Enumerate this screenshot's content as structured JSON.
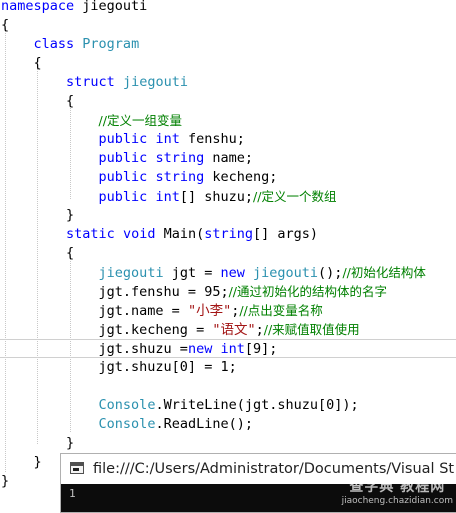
{
  "editor": {
    "colors": {
      "keyword": "#0000ff",
      "type": "#2b91af",
      "string": "#a31515",
      "comment": "#008000",
      "text": "#000000"
    },
    "lines": [
      {
        "tokens": [
          {
            "t": "kw",
            "v": "namespace"
          },
          {
            "t": "tx",
            "v": " jiegouti"
          }
        ]
      },
      {
        "tokens": [
          {
            "t": "tx",
            "v": "{"
          }
        ]
      },
      {
        "tokens": [
          {
            "t": "tx",
            "v": "    "
          },
          {
            "t": "kw",
            "v": "class"
          },
          {
            "t": "tx",
            "v": " "
          },
          {
            "t": "ty",
            "v": "Program"
          }
        ]
      },
      {
        "tokens": [
          {
            "t": "tx",
            "v": "    {"
          }
        ]
      },
      {
        "tokens": [
          {
            "t": "tx",
            "v": "        "
          },
          {
            "t": "kw",
            "v": "struct"
          },
          {
            "t": "tx",
            "v": " "
          },
          {
            "t": "ty",
            "v": "jiegouti"
          }
        ]
      },
      {
        "tokens": [
          {
            "t": "tx",
            "v": "        {"
          }
        ]
      },
      {
        "tokens": [
          {
            "t": "tx",
            "v": "            "
          },
          {
            "t": "cm",
            "v": "//定义一组变量"
          }
        ]
      },
      {
        "tokens": [
          {
            "t": "tx",
            "v": "            "
          },
          {
            "t": "kw",
            "v": "public"
          },
          {
            "t": "tx",
            "v": " "
          },
          {
            "t": "kw",
            "v": "int"
          },
          {
            "t": "tx",
            "v": " fenshu;"
          }
        ]
      },
      {
        "tokens": [
          {
            "t": "tx",
            "v": "            "
          },
          {
            "t": "kw",
            "v": "public"
          },
          {
            "t": "tx",
            "v": " "
          },
          {
            "t": "kw",
            "v": "string"
          },
          {
            "t": "tx",
            "v": " name;"
          }
        ]
      },
      {
        "tokens": [
          {
            "t": "tx",
            "v": "            "
          },
          {
            "t": "kw",
            "v": "public"
          },
          {
            "t": "tx",
            "v": " "
          },
          {
            "t": "kw",
            "v": "string"
          },
          {
            "t": "tx",
            "v": " kecheng;"
          }
        ]
      },
      {
        "tokens": [
          {
            "t": "tx",
            "v": "            "
          },
          {
            "t": "kw",
            "v": "public"
          },
          {
            "t": "tx",
            "v": " "
          },
          {
            "t": "kw",
            "v": "int"
          },
          {
            "t": "tx",
            "v": "[] shuzu;"
          },
          {
            "t": "cm",
            "v": "//定义一个数组"
          }
        ]
      },
      {
        "tokens": [
          {
            "t": "tx",
            "v": "        }"
          }
        ]
      },
      {
        "tokens": [
          {
            "t": "tx",
            "v": "        "
          },
          {
            "t": "kw",
            "v": "static"
          },
          {
            "t": "tx",
            "v": " "
          },
          {
            "t": "kw",
            "v": "void"
          },
          {
            "t": "tx",
            "v": " Main("
          },
          {
            "t": "kw",
            "v": "string"
          },
          {
            "t": "tx",
            "v": "[] args)"
          }
        ]
      },
      {
        "tokens": [
          {
            "t": "tx",
            "v": "        {"
          }
        ]
      },
      {
        "tokens": [
          {
            "t": "tx",
            "v": "            "
          },
          {
            "t": "ty",
            "v": "jiegouti"
          },
          {
            "t": "tx",
            "v": " jgt = "
          },
          {
            "t": "kw",
            "v": "new"
          },
          {
            "t": "tx",
            "v": " "
          },
          {
            "t": "ty",
            "v": "jiegouti"
          },
          {
            "t": "tx",
            "v": "();"
          },
          {
            "t": "cm",
            "v": "//初始化结构体"
          }
        ]
      },
      {
        "tokens": [
          {
            "t": "tx",
            "v": "            jgt.fenshu = 95;"
          },
          {
            "t": "cm",
            "v": "//通过初始化的结构体的名字"
          }
        ]
      },
      {
        "tokens": [
          {
            "t": "tx",
            "v": "            jgt.name = "
          },
          {
            "t": "str",
            "v": "\"小李\""
          },
          {
            "t": "tx",
            "v": ";"
          },
          {
            "t": "cm",
            "v": "//点出变量名称"
          }
        ]
      },
      {
        "tokens": [
          {
            "t": "tx",
            "v": "            jgt.kecheng = "
          },
          {
            "t": "str",
            "v": "\"语文\""
          },
          {
            "t": "tx",
            "v": ";"
          },
          {
            "t": "cm",
            "v": "//来赋值取值使用"
          }
        ]
      },
      {
        "tokens": [
          {
            "t": "tx",
            "v": "            jgt.shuzu ="
          },
          {
            "t": "kw",
            "v": "new"
          },
          {
            "t": "tx",
            "v": " "
          },
          {
            "t": "kw",
            "v": "int"
          },
          {
            "t": "tx",
            "v": "[9];"
          }
        ],
        "highlighted": true
      },
      {
        "tokens": [
          {
            "t": "tx",
            "v": "            jgt.shuzu[0] = 1;"
          }
        ]
      },
      {
        "tokens": []
      },
      {
        "tokens": [
          {
            "t": "tx",
            "v": "            "
          },
          {
            "t": "ty",
            "v": "Console"
          },
          {
            "t": "tx",
            "v": ".WriteLine(jgt.shuzu[0]);"
          }
        ]
      },
      {
        "tokens": [
          {
            "t": "tx",
            "v": "            "
          },
          {
            "t": "ty",
            "v": "Console"
          },
          {
            "t": "tx",
            "v": ".ReadLine();"
          }
        ]
      },
      {
        "tokens": [
          {
            "t": "tx",
            "v": "        }"
          }
        ]
      },
      {
        "tokens": [
          {
            "t": "tx",
            "v": "    }"
          }
        ]
      },
      {
        "tokens": [
          {
            "t": "tx",
            "v": "}"
          }
        ]
      }
    ]
  },
  "console": {
    "title": "file:///C:/Users/Administrator/Documents/Visual St",
    "output": "1",
    "app_icon": "console-app-icon"
  },
  "watermark": {
    "title": "查字典 教程网",
    "url": "jiaocheng.chazidian.com"
  }
}
